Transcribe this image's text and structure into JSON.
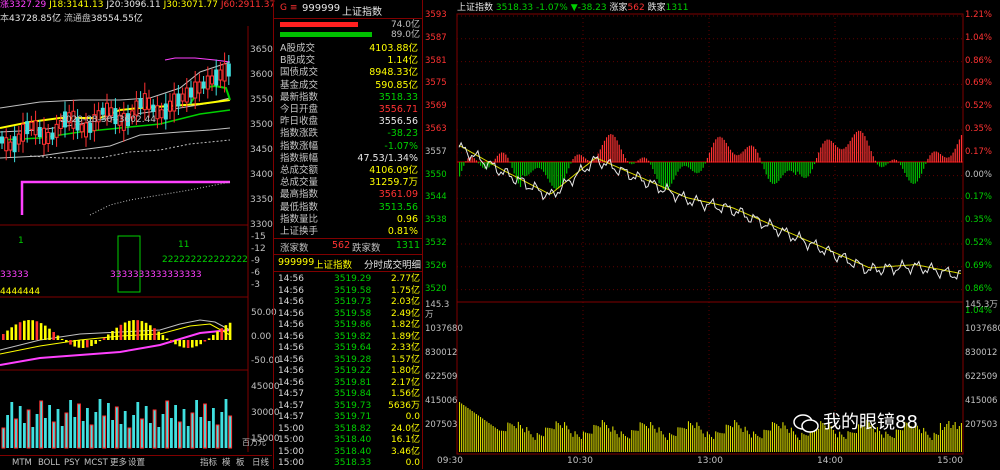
{
  "left_panel": {
    "header": {
      "c1": "涨",
      "v1": "3327.29",
      "c2": "J18:",
      "v2": "3141.13",
      "c3": "J20:",
      "v3": "3096.11",
      "c4": "J30:",
      "v4": "3071.77",
      "c5": "J60:",
      "v5": "2911.37"
    },
    "sub_header": {
      "cap_label": "本",
      "cap_value": "43728.85亿",
      "float_label": "流通盘",
      "float_value": "38554.55亿"
    },
    "price_axis": [
      "3650",
      "3600",
      "3550",
      "3500",
      "3450",
      "3400",
      "3350",
      "3300"
    ],
    "ma_tag": "2020-08-30--3602.44",
    "macd_axis": [
      "-15",
      "-12",
      "-9",
      "-6",
      "-3"
    ],
    "kdj_marks": [
      "1",
      "11",
      "222222222222222",
      "3333333333333333",
      "33333",
      "4444444"
    ],
    "ind_axis": [
      "50.00",
      "0.00",
      "-50.00"
    ],
    "vol_axis": [
      "45000",
      "30000",
      "15000"
    ],
    "vol_unit": "百万元",
    "tabs": [
      "MTM",
      "BOLL",
      "PSY",
      "MCST",
      "更多",
      "设置"
    ],
    "tools": [
      "指标",
      "模",
      "板",
      "日线"
    ]
  },
  "middle": {
    "code": "999999",
    "name": "上证指数",
    "bar1_label": "74.0亿",
    "bar2_label": "89.0亿",
    "stats": [
      {
        "k": "A股成交",
        "v": "4103.88亿",
        "c": "yel"
      },
      {
        "k": "B股成交",
        "v": "1.14亿",
        "c": "yel"
      },
      {
        "k": "国债成交",
        "v": "8948.33亿",
        "c": "yel"
      },
      {
        "k": "基金成交",
        "v": "590.85亿",
        "c": "yel"
      },
      {
        "k": "最新指数",
        "v": "3518.33",
        "c": "grn"
      },
      {
        "k": "今日开盘",
        "v": "3556.71",
        "c": "red"
      },
      {
        "k": "昨日收盘",
        "v": "3556.56",
        "c": "wht"
      },
      {
        "k": "指数涨跌",
        "v": "-38.23",
        "c": "grn"
      },
      {
        "k": "指数涨幅",
        "v": "-1.07%",
        "c": "grn"
      },
      {
        "k": "指数振幅",
        "v": "47.53/1.34%",
        "c": "wht"
      },
      {
        "k": "总成交额",
        "v": "4106.09亿",
        "c": "yel"
      },
      {
        "k": "总成交量",
        "v": "31259.7万",
        "c": "yel"
      },
      {
        "k": "最高指数",
        "v": "3561.09",
        "c": "red"
      },
      {
        "k": "最低指数",
        "v": "3513.56",
        "c": "grn"
      },
      {
        "k": "指数量比",
        "v": "0.96",
        "c": "yel"
      },
      {
        "k": "上证换手",
        "v": "0.81%",
        "c": "yel"
      }
    ],
    "up_label": "涨家数",
    "up_value": "562",
    "down_label": "跌家数",
    "down_value": "1311",
    "tick_header_code": "999999",
    "tick_header_name": "上证指数",
    "tick_header_title": "分时成交明细",
    "ticks": [
      {
        "t": "14:56",
        "p": "3519.29",
        "v": "2.77亿"
      },
      {
        "t": "14:56",
        "p": "3519.58",
        "v": "1.75亿"
      },
      {
        "t": "14:56",
        "p": "3519.73",
        "v": "2.03亿"
      },
      {
        "t": "14:56",
        "p": "3519.58",
        "v": "2.49亿"
      },
      {
        "t": "14:56",
        "p": "3519.86",
        "v": "1.82亿"
      },
      {
        "t": "14:56",
        "p": "3519.82",
        "v": "1.89亿"
      },
      {
        "t": "14:56",
        "p": "3519.64",
        "v": "2.33亿"
      },
      {
        "t": "14:56",
        "p": "3519.28",
        "v": "1.57亿"
      },
      {
        "t": "14:56",
        "p": "3519.22",
        "v": "1.80亿"
      },
      {
        "t": "14:56",
        "p": "3519.81",
        "v": "2.17亿"
      },
      {
        "t": "14:57",
        "p": "3519.84",
        "v": "1.56亿"
      },
      {
        "t": "14:57",
        "p": "3519.73",
        "v": "5636万"
      },
      {
        "t": "14:57",
        "p": "3519.71",
        "v": "0.0"
      },
      {
        "t": "15:00",
        "p": "3518.82",
        "v": "24.0亿"
      },
      {
        "t": "15:00",
        "p": "3518.40",
        "v": "16.1亿"
      },
      {
        "t": "15:00",
        "p": "3518.40",
        "v": "3.46亿"
      },
      {
        "t": "15:00",
        "p": "3518.33",
        "v": "0.0"
      }
    ]
  },
  "right_panel": {
    "header": {
      "name": "上证指数",
      "price": "3518.33",
      "pct": "-1.07%",
      "chg": "▼-38.23",
      "up_label": "涨家",
      "up": "562",
      "down_label": "跌家",
      "down": "1311"
    },
    "price_axis": [
      "3593",
      "3587",
      "3581",
      "3575",
      "3569",
      "3563",
      "3557",
      "3550",
      "3544",
      "3538",
      "3532",
      "3526",
      "3520"
    ],
    "pct_axis": [
      "1.21%",
      "1.04%",
      "0.86%",
      "0.69%",
      "0.52%",
      "0.35%",
      "0.17%",
      "0.00%",
      "0.17%",
      "0.35%",
      "0.52%",
      "0.69%",
      "0.86%",
      "1.04%"
    ],
    "vol_axis": [
      "145.3万",
      "130.8万",
      "109.0万",
      "87.2万",
      "65.4万",
      "43.6万",
      "21.8万"
    ],
    "vol_axis_left": [
      "145.3万",
      "1037680",
      "830012",
      "622509",
      "415006",
      "207503"
    ],
    "vol_axis_right": [
      "145.3万",
      "1037680",
      "830012",
      "622509",
      "415006",
      "207503"
    ],
    "time_axis": [
      "09:30",
      "10:30",
      "13:00",
      "14:00",
      "15:00"
    ],
    "watermark": "我的眼镜88"
  },
  "chart_data": {
    "type": "line",
    "title": "上证指数",
    "x": [
      "09:30",
      "10:30",
      "13:00",
      "14:00",
      "15:00"
    ],
    "ylim": [
      3514,
      3596
    ],
    "series": [
      {
        "name": "上证指数",
        "values": [
          3556.71,
          3549,
          3542,
          3553,
          3547,
          3541,
          3538,
          3532,
          3526,
          3520,
          3521,
          3518.33
        ]
      }
    ]
  }
}
